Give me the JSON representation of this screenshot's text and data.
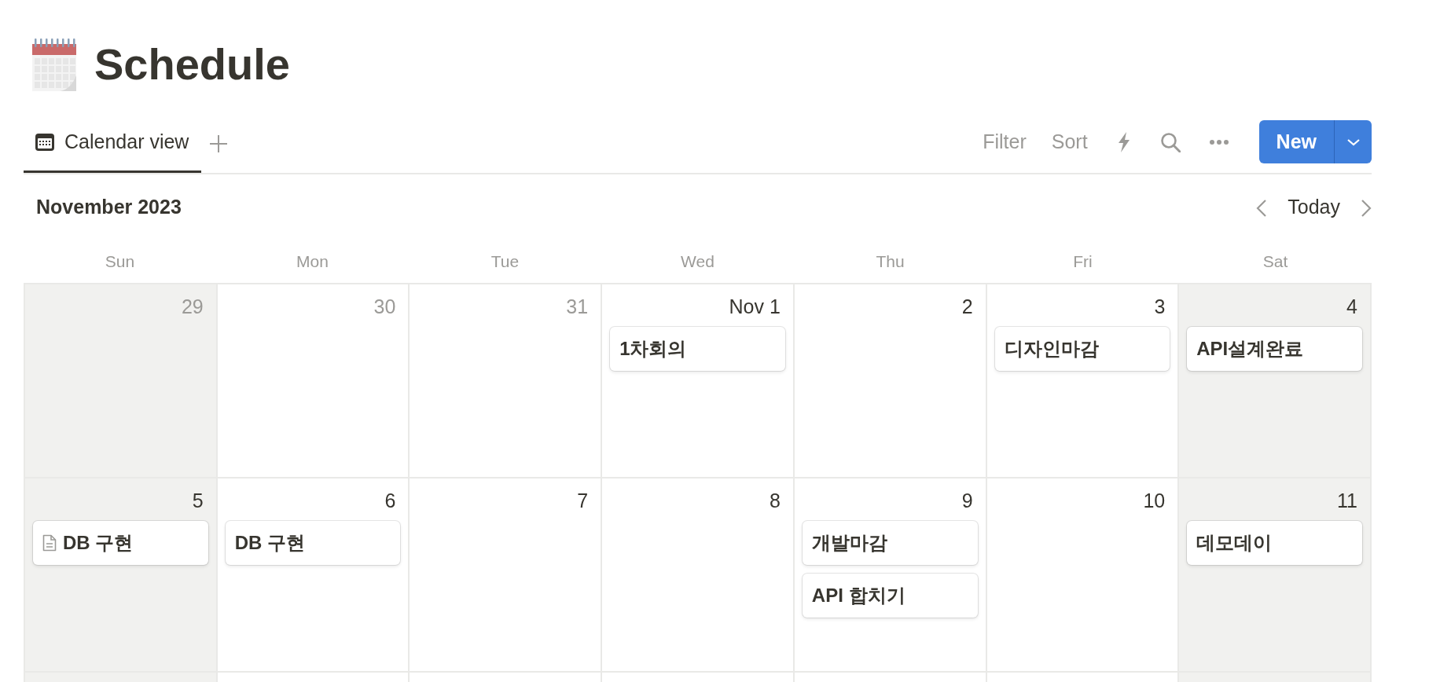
{
  "page": {
    "title": "Schedule"
  },
  "views": [
    {
      "label": "Calendar view",
      "selected": true
    }
  ],
  "toolbar": {
    "filter": "Filter",
    "sort": "Sort",
    "new_button": "New"
  },
  "calendar": {
    "month": "November 2023",
    "today": "Today",
    "weekdays": [
      "Sun",
      "Mon",
      "Tue",
      "Wed",
      "Thu",
      "Fri",
      "Sat"
    ],
    "weeks": [
      [
        {
          "date": "29",
          "in_month": false,
          "weekend": true
        },
        {
          "date": "30",
          "in_month": false,
          "weekend": false
        },
        {
          "date": "31",
          "in_month": false,
          "weekend": false
        },
        {
          "date": "Nov 1",
          "in_month": true,
          "weekend": false,
          "events": [
            {
              "title": "1차회의",
              "page_icon": false
            }
          ]
        },
        {
          "date": "2",
          "in_month": true,
          "weekend": false
        },
        {
          "date": "3",
          "in_month": true,
          "weekend": false,
          "events": [
            {
              "title": "디자인마감",
              "page_icon": false
            }
          ]
        },
        {
          "date": "4",
          "in_month": true,
          "weekend": true,
          "events": [
            {
              "title": "API설계완료",
              "page_icon": false
            }
          ]
        }
      ],
      [
        {
          "date": "5",
          "in_month": true,
          "weekend": true,
          "events": [
            {
              "title": "DB 구현",
              "page_icon": true
            }
          ]
        },
        {
          "date": "6",
          "in_month": true,
          "weekend": false,
          "events": [
            {
              "title": "DB 구현",
              "page_icon": false
            }
          ]
        },
        {
          "date": "7",
          "in_month": true,
          "weekend": false
        },
        {
          "date": "8",
          "in_month": true,
          "weekend": false
        },
        {
          "date": "9",
          "in_month": true,
          "weekend": false,
          "events": [
            {
              "title": "개발마감",
              "page_icon": false
            },
            {
              "title": "API 합치기",
              "page_icon": false
            }
          ]
        },
        {
          "date": "10",
          "in_month": true,
          "weekend": false
        },
        {
          "date": "11",
          "in_month": true,
          "weekend": true,
          "events": [
            {
              "title": "데모데이",
              "page_icon": false
            }
          ]
        }
      ]
    ]
  }
}
